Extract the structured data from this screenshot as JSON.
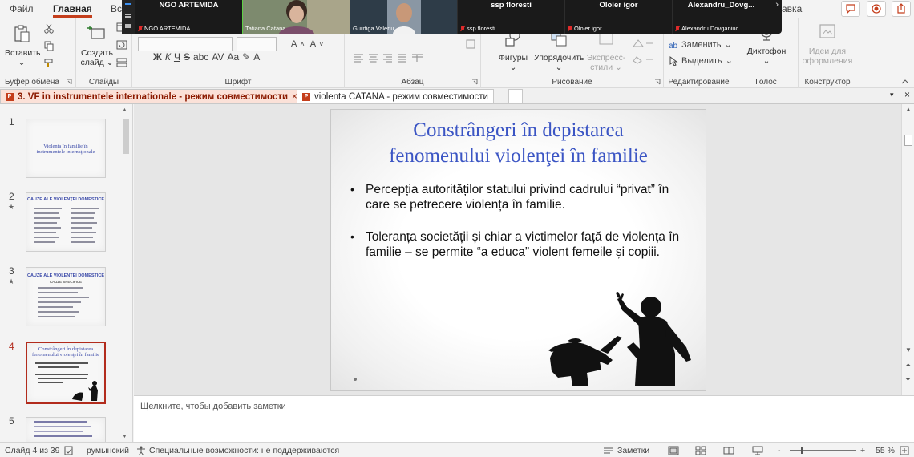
{
  "menu": {
    "tabs": [
      {
        "label": "Файл",
        "active": false
      },
      {
        "label": "Главная",
        "active": true
      },
      {
        "label": "Вст",
        "active": false
      }
    ],
    "right_tab_fragment": "авка"
  },
  "zoom": {
    "participants": [
      {
        "name": "NGO ARTEMIDA",
        "label": "NGO ARTEMIDA",
        "muted": true,
        "video": false
      },
      {
        "name": "",
        "label": "Tatiana Catana",
        "muted": false,
        "video": true,
        "active": true
      },
      {
        "name": "",
        "label": "Gurdiga Valeriu",
        "muted": false,
        "video": true
      },
      {
        "name": "ssp floresti",
        "label": "ssp floresti",
        "muted": true,
        "video": false
      },
      {
        "name": "Oloier igor",
        "label": "Oloier igor",
        "muted": true,
        "video": false
      },
      {
        "name": "Alexandru_Dovg...",
        "label": "Alexandru Dovganiuc",
        "muted": true,
        "video": false
      }
    ],
    "next_arrow": "›"
  },
  "ribbon": {
    "clipboard": {
      "paste": "Вставить",
      "label": "Буфер обмена"
    },
    "slides": {
      "new_slide_line1": "Создать",
      "new_slide_line2": "слайд",
      "label": "Слайды"
    },
    "font": {
      "bold": "Ж",
      "italic": "К",
      "underline": "Ч",
      "strike": "S",
      "shadow": "abc",
      "spacing": "AV",
      "case": "Aa",
      "label": "Шрифт"
    },
    "paragraph": {
      "label": "Абзац"
    },
    "drawing": {
      "shapes": "Фигуры",
      "arrange": "Упорядочить",
      "quick_styles_line1": "Экспресс-",
      "quick_styles_line2": "стили",
      "label": "Рисование"
    },
    "editing": {
      "replace": "Заменить",
      "select": "Выделить",
      "label": "Редактирование"
    },
    "voice": {
      "dictate": "Диктофон",
      "label": "Голос"
    },
    "designer": {
      "ideas_line1": "Идеи для",
      "ideas_line2": "оформления",
      "label": "Конструктор"
    }
  },
  "doc_tabs": [
    {
      "title": "3. VF in instrumentele  internationale  -  режим совместимости",
      "active": true
    },
    {
      "title": "violenta CATANA  -  режим совместимости",
      "active": false
    }
  ],
  "thumbnails": [
    {
      "num": "1",
      "title": "Violenta în familie în instrumentele internaţionale",
      "star": false
    },
    {
      "num": "2",
      "title": "CAUZE ALE VIOLENŢEI DOMESTICE",
      "star": true
    },
    {
      "num": "3",
      "title": "CAUZE ALE VIOLENŢEI DOMESTICE",
      "subtitle": "CAUZE SPECIFICE",
      "star": true
    },
    {
      "num": "4",
      "title": "Constrângeri în depistarea fenomenului violenţei în familie",
      "star": false,
      "selected": true
    },
    {
      "num": "5",
      "title": "",
      "star": false
    }
  ],
  "slide": {
    "title_line1": "Constrângeri în depistarea",
    "title_line2": "fenomenului violenţei în familie",
    "bullets": [
      "Percepția autorităților statului privind cadrului “privat” în care se petrecere violența în familie.",
      "Toleranța societății și chiar a victimelor față de violența în familie – se permite “a educa” violent femeile și copiii."
    ]
  },
  "notes": {
    "placeholder": "Щелкните, чтобы добавить заметки"
  },
  "status": {
    "slide_pos": "Слайд 4 из 39",
    "language": "румынский",
    "accessibility": "Специальные возможности: не поддерживаются",
    "notes_btn": "Заметки",
    "zoom_minus": "-",
    "zoom_plus": "+",
    "zoom_pct": "55 %",
    "zoom_fraction": 0.55
  },
  "colors": {
    "accent": "#c43e1c",
    "title_blue": "#3b55c4",
    "active_speaker": "#5fd145"
  }
}
